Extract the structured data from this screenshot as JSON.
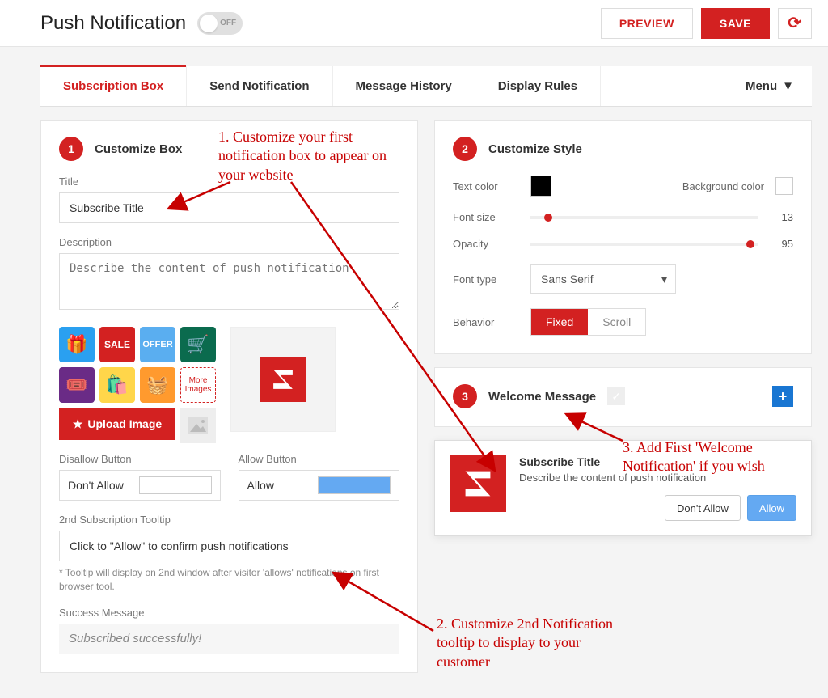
{
  "header": {
    "title": "Push Notification",
    "toggle_state": "OFF",
    "preview_label": "PREVIEW",
    "save_label": "SAVE"
  },
  "tabs": {
    "items": [
      "Subscription Box",
      "Send Notification",
      "Message History",
      "Display Rules"
    ],
    "menu_label": "Menu"
  },
  "step1": {
    "num": "1",
    "title": "Customize Box",
    "title_label": "Title",
    "title_value": "Subscribe Title",
    "desc_label": "Description",
    "desc_placeholder": "Describe the content of push notification",
    "more_images": "More Images",
    "upload_label": "Upload Image",
    "disallow_label": "Disallow Button",
    "disallow_value": "Don't Allow",
    "allow_label": "Allow Button",
    "allow_value": "Allow",
    "tooltip_label": "2nd Subscription Tooltip",
    "tooltip_value": "Click to \"Allow\" to confirm push notifications",
    "tooltip_help": "* Tooltip will display on 2nd window after visitor 'allows' notifications on first browser tool.",
    "success_label": "Success Message",
    "success_value": "Subscribed successfully!"
  },
  "step2": {
    "num": "2",
    "title": "Customize Style",
    "textcolor_label": "Text color",
    "textcolor_value": "#000000",
    "bgcolor_label": "Background color",
    "bgcolor_value": "#ffffff",
    "fontsize_label": "Font size",
    "fontsize_value": "13",
    "opacity_label": "Opacity",
    "opacity_value": "95",
    "fonttype_label": "Font type",
    "fonttype_value": "Sans Serif",
    "behavior_label": "Behavior",
    "behavior_options": [
      "Fixed",
      "Scroll"
    ]
  },
  "step3": {
    "num": "3",
    "title": "Welcome Message"
  },
  "preview": {
    "title": "Subscribe Title",
    "desc": "Describe the content of push notification",
    "deny": "Don't Allow",
    "allow": "Allow"
  },
  "annotations": {
    "a1": "1. Customize your first notification box to appear on your website",
    "a2": "2. Customize 2nd Notification tooltip to display to your customer",
    "a3": "3. Add First 'Welcome Notification' if you wish"
  }
}
